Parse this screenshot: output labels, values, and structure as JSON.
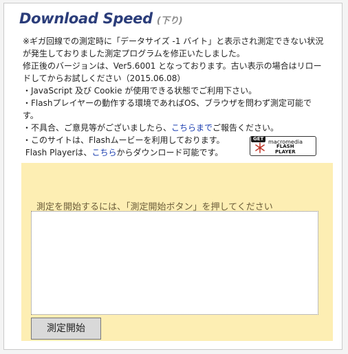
{
  "header": {
    "title": "Download Speed",
    "subtitle": "(下り)"
  },
  "notice": {
    "line1": "※ギガ回線での測定時に「データサイズ -1 バイト」と表示され測定できない状況が発生しておりました測定プログラムを修正いたしました。",
    "line2": "修正後のバージョンは、Ver5.6001 となっております。古い表示の場合はリロードしてからお試しください（2015.06.08）",
    "bullet_js": "・JavaScript 及び Cookie が使用できる状態でご利用下さい。",
    "bullet_flash": "・Flashプレイヤーの動作する環境であればOS、ブラウザを問わず測定可能です。",
    "bullet_report_pre": "・不具合、ご意見等がございましたら、",
    "bullet_report_link": "こちらまで",
    "bullet_report_post": "ご報告ください。",
    "site_flash": "・このサイトは、Flashムービーを利用しております。",
    "player_pre": "Flash Playerは、",
    "player_link": "こちら",
    "player_post": "からダウンロード可能です。"
  },
  "badge": {
    "get": "GET",
    "brand": "macromedia",
    "product_line1": "FLASH",
    "product_line2": "PLAYER"
  },
  "measure": {
    "prompt": "測定を開始するには、「測定開始ボタン」を押してください",
    "start_button": "測定開始"
  },
  "colors": {
    "title": "#2b3d7a",
    "panel": "#fdeeb3",
    "link": "#1a3db0"
  },
  "icons": {
    "badge_star": "flash-star-icon"
  }
}
